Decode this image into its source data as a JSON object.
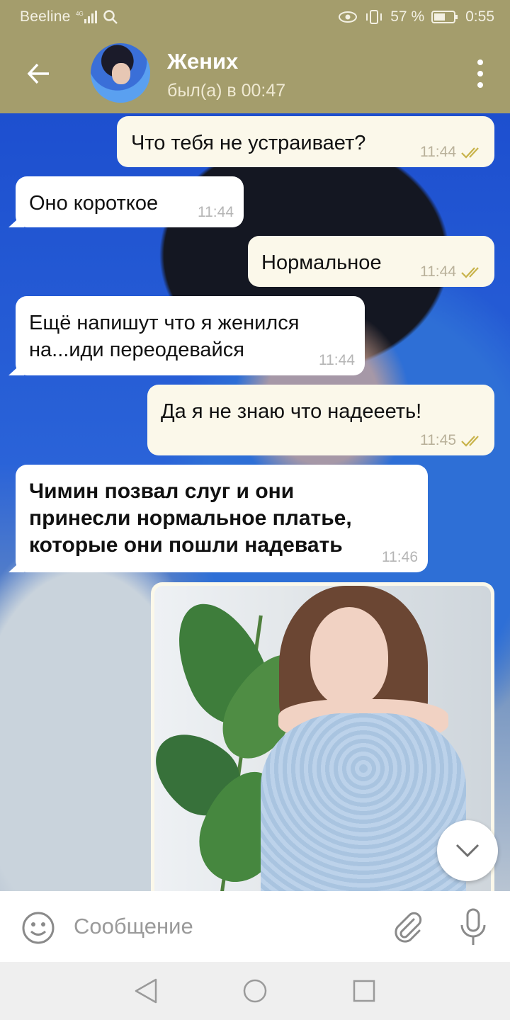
{
  "status_bar": {
    "carrier": "Beeline",
    "network": "4G",
    "battery_percent": "57 %",
    "time": "0:55"
  },
  "header": {
    "contact_name": "Жених",
    "last_seen": "был(а) в 00:47",
    "icons": [
      "back-arrow-icon",
      "avatar",
      "more-vertical-icon"
    ]
  },
  "messages": [
    {
      "direction": "out",
      "text": "Что тебя не устраивает?",
      "time": "11:44",
      "read": true
    },
    {
      "direction": "in",
      "text": "Оно короткое",
      "time": "11:44"
    },
    {
      "direction": "out",
      "text": "Нормальное",
      "time": "11:44",
      "read": true
    },
    {
      "direction": "in",
      "text": "Ещё напишут что я женился на...иди переодевайся",
      "time": "11:44"
    },
    {
      "direction": "out",
      "text": "Да я не знаю что надеееть!",
      "time": "11:45",
      "read": true
    },
    {
      "direction": "in",
      "text": "Чимин позвал слуг и они принесли нормальное платье, которые они пошли надевать",
      "time": "11:46",
      "bold": true
    },
    {
      "direction": "out",
      "type": "photo"
    }
  ],
  "composer": {
    "placeholder": "Сообщение",
    "value": ""
  },
  "colors": {
    "header": "#a49d6c",
    "outgoing_bubble": "#fbf8ea",
    "incoming_bubble": "#ffffff",
    "check_marks": "#c8b34a"
  }
}
